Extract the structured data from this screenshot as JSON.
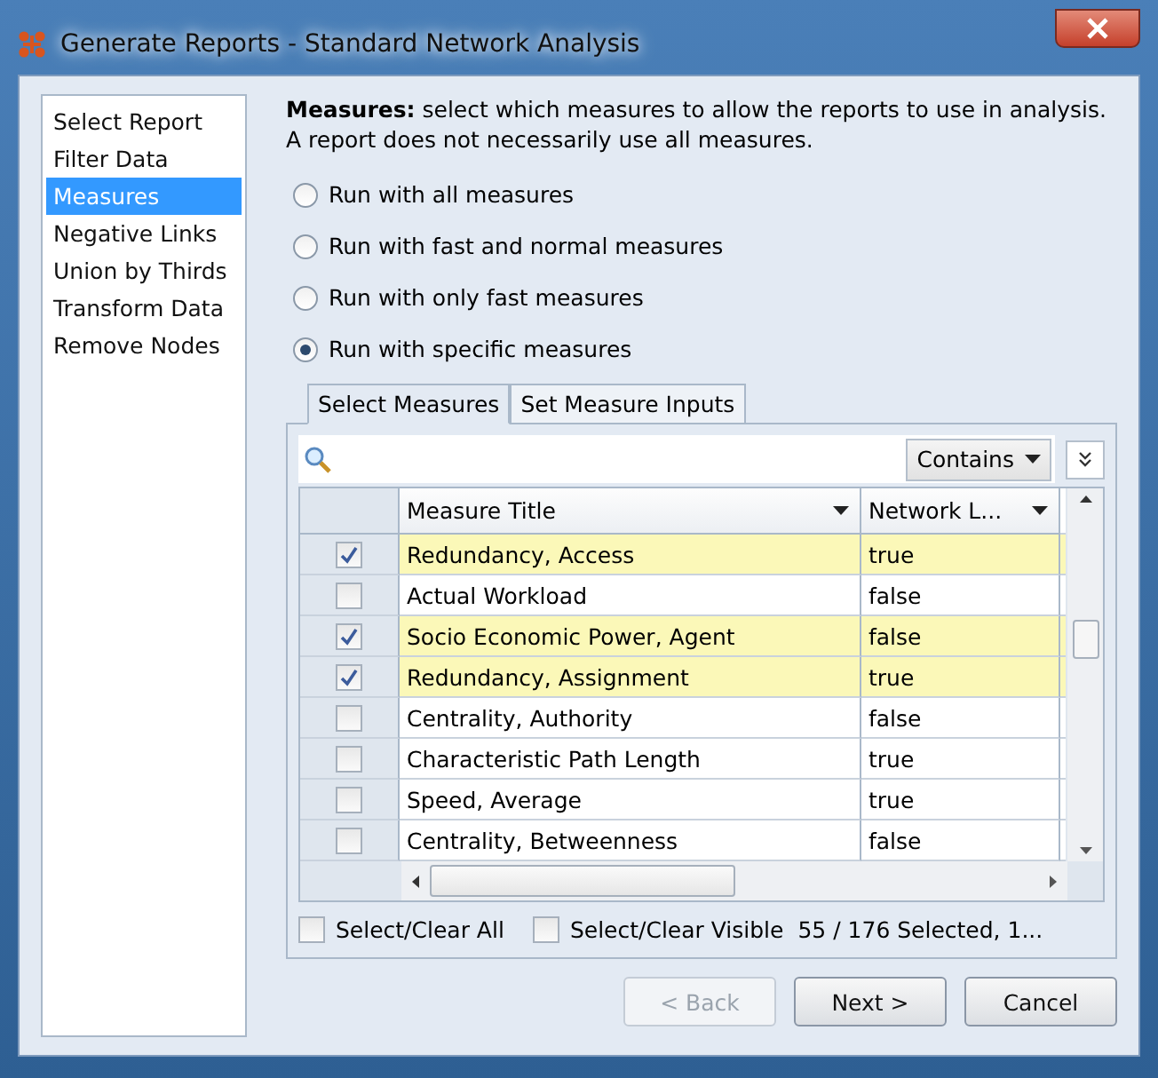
{
  "window": {
    "title": "Generate Reports - Standard Network Analysis"
  },
  "sidebar": {
    "items": [
      {
        "label": "Select Report",
        "selected": false
      },
      {
        "label": "Filter Data",
        "selected": false
      },
      {
        "label": "Measures",
        "selected": true
      },
      {
        "label": "Negative Links",
        "selected": false
      },
      {
        "label": "Union by Thirds",
        "selected": false
      },
      {
        "label": "Transform Data",
        "selected": false
      },
      {
        "label": "Remove Nodes",
        "selected": false
      }
    ]
  },
  "description": "**Measures:** select which measures to allow the reports to use in analysis. A report does not necessarily use all measures.",
  "options": [
    {
      "label": "Run with all measures",
      "selected": false
    },
    {
      "label": "Run with fast and normal measures",
      "selected": false
    },
    {
      "label": "Run with only fast measures",
      "selected": false
    },
    {
      "label": "Run with specific measures",
      "selected": true
    }
  ],
  "tabs": [
    {
      "label": "Select Measures",
      "selected": true
    },
    {
      "label": "Set Measure Inputs",
      "selected": false
    }
  ],
  "filter": {
    "mode": "Contains"
  },
  "table": {
    "columns": [
      "Measure Title",
      "Network L..."
    ],
    "rows": [
      {
        "checked": true,
        "title": "Redundancy, Access",
        "network": "true"
      },
      {
        "checked": false,
        "title": "Actual Workload",
        "network": "false"
      },
      {
        "checked": true,
        "title": "Socio Economic Power, Agent",
        "network": "false"
      },
      {
        "checked": true,
        "title": "Redundancy, Assignment",
        "network": "true"
      },
      {
        "checked": false,
        "title": "Centrality, Authority",
        "network": "false"
      },
      {
        "checked": false,
        "title": "Characteristic Path Length",
        "network": "true"
      },
      {
        "checked": false,
        "title": "Speed, Average",
        "network": "true"
      },
      {
        "checked": false,
        "title": "Centrality, Betweenness",
        "network": "false"
      }
    ]
  },
  "footer": {
    "checkboxes": [
      {
        "label": "Select/Clear All",
        "checked": false
      },
      {
        "label": "Select/Clear Visible",
        "checked": false
      }
    ],
    "summary": "55 / 176 Selected, 1..."
  },
  "buttons": [
    {
      "label": "< Back",
      "disabled": true
    },
    {
      "label": "Next >",
      "disabled": false
    },
    {
      "label": "Cancel",
      "disabled": false
    }
  ]
}
